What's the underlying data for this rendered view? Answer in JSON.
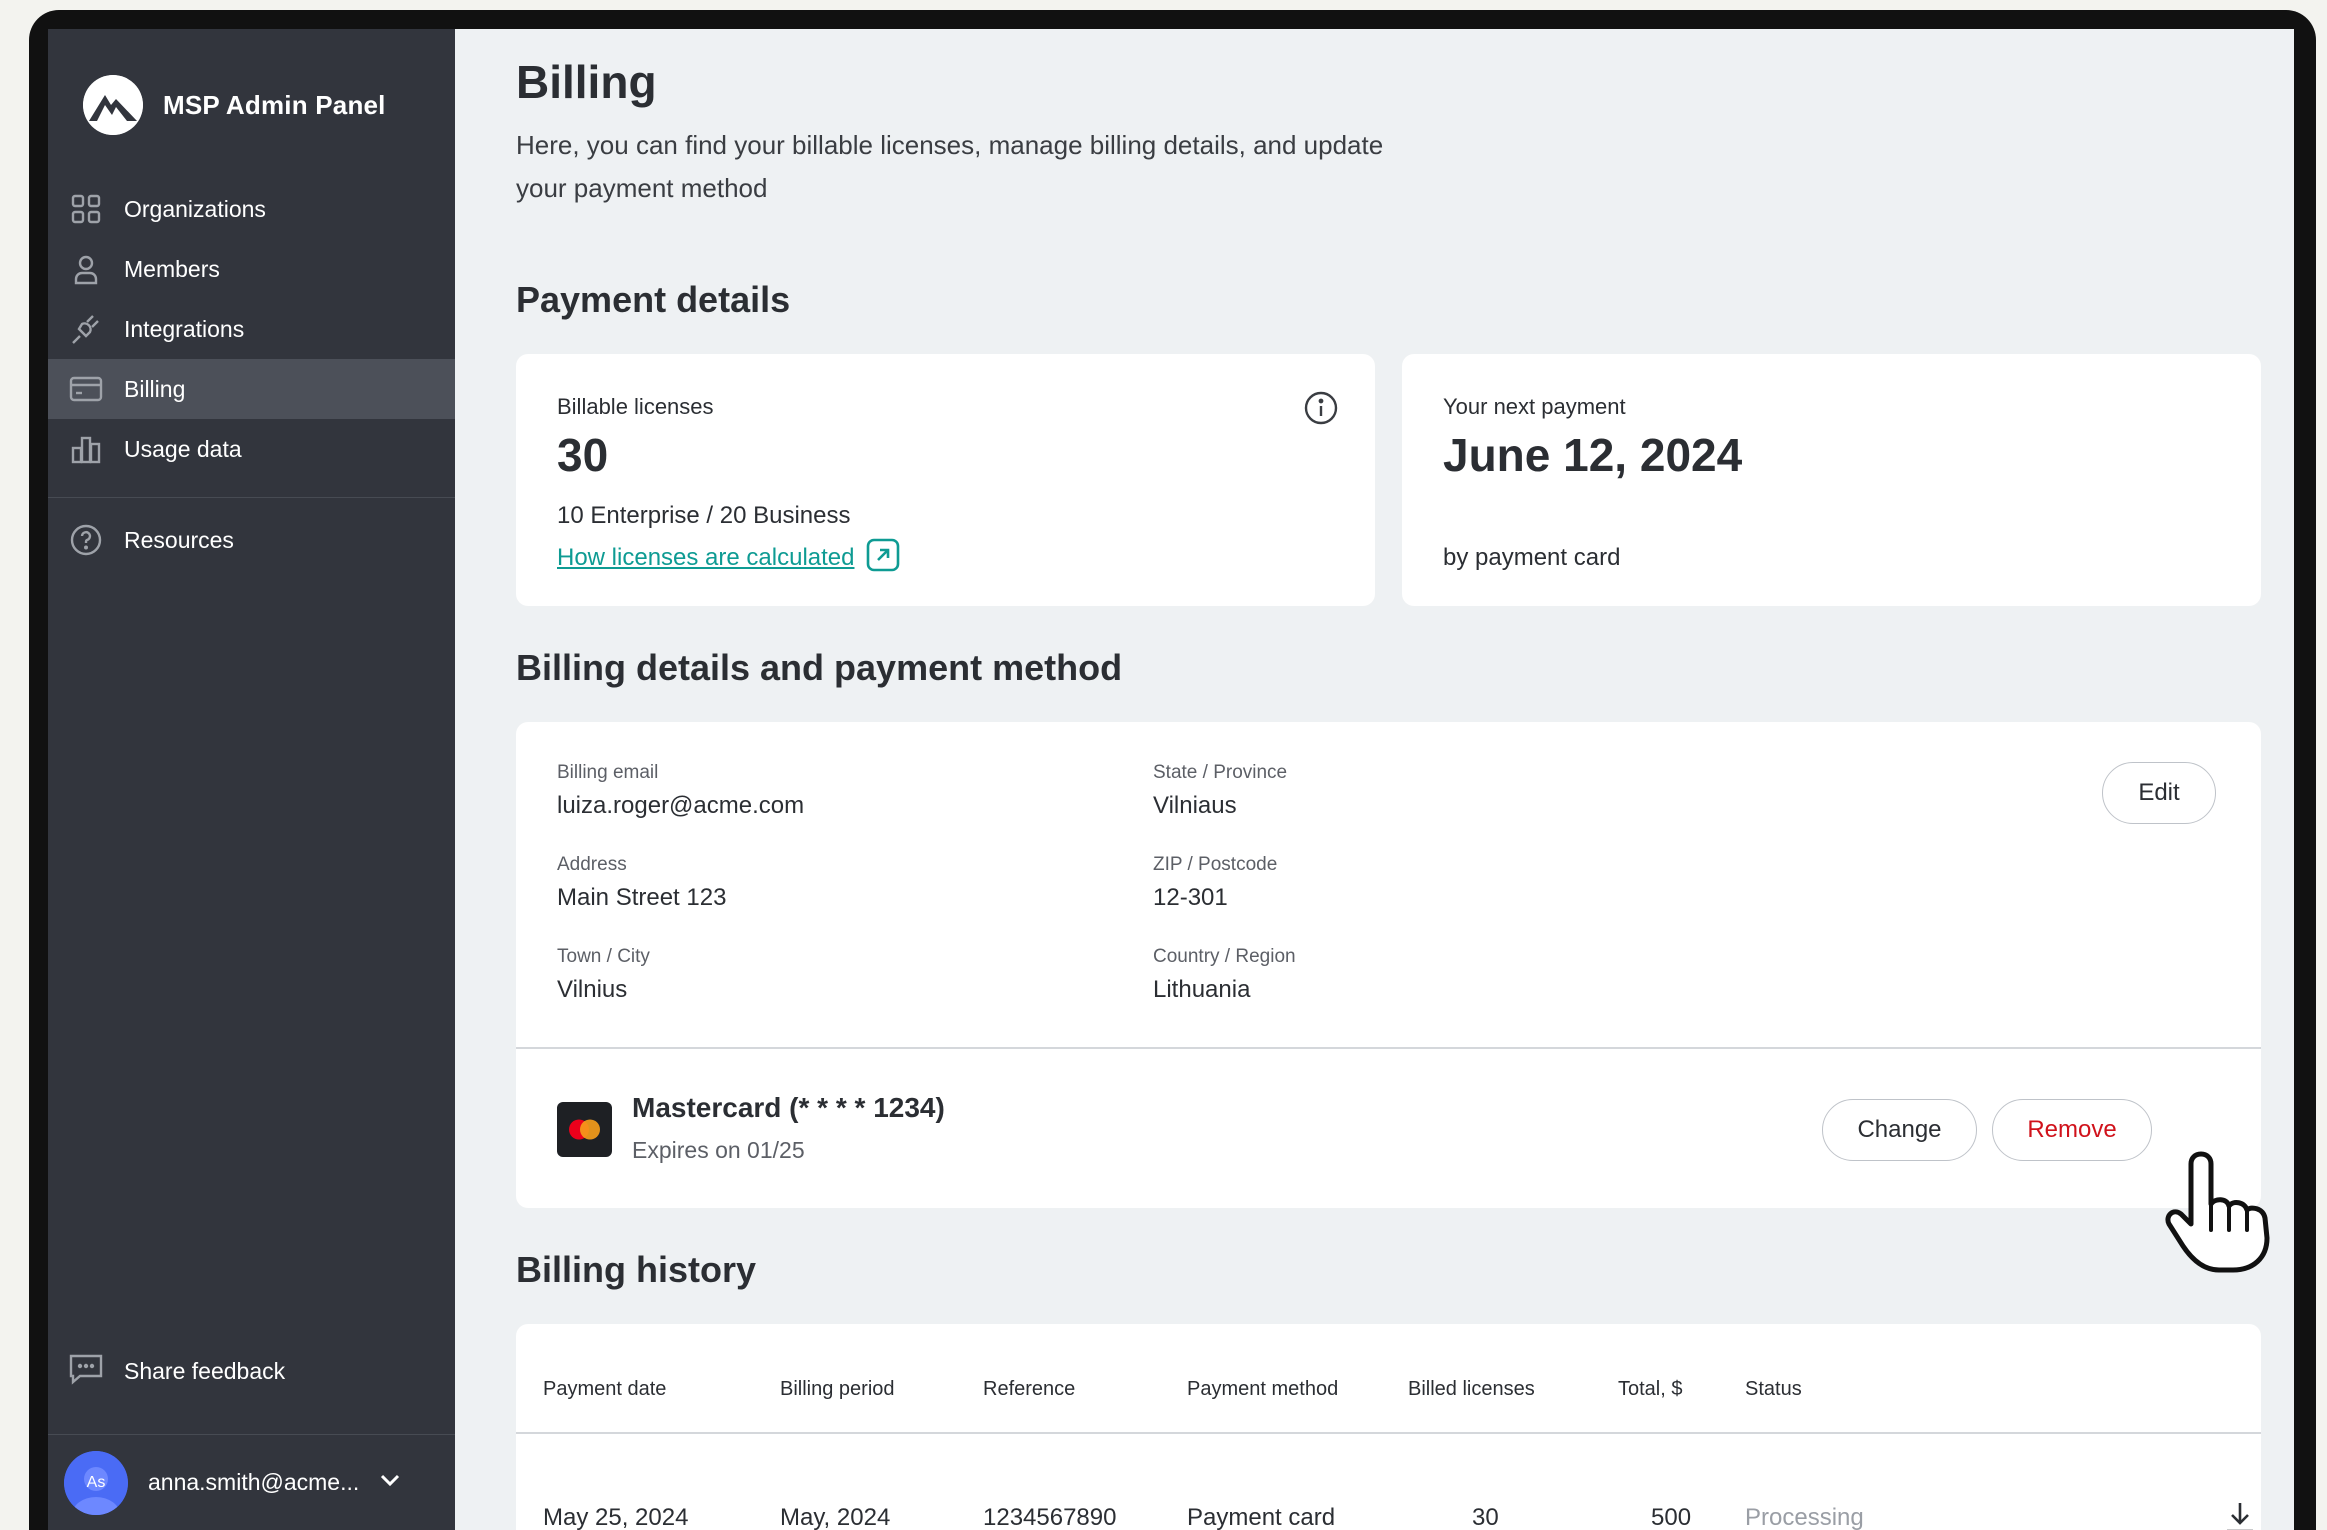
{
  "app": {
    "name": "MSP Admin Panel"
  },
  "sidebar": {
    "items": [
      {
        "label": "Organizations",
        "icon": "grid-icon"
      },
      {
        "label": "Members",
        "icon": "person-icon"
      },
      {
        "label": "Integrations",
        "icon": "plug-icon"
      },
      {
        "label": "Billing",
        "icon": "card-icon",
        "active": true
      },
      {
        "label": "Usage data",
        "icon": "bar-chart-icon"
      }
    ],
    "resources": "Resources",
    "feedback": "Share feedback",
    "user": {
      "initials": "As",
      "email": "anna.smith@acme..."
    }
  },
  "page": {
    "title": "Billing",
    "subtitle": "Here, you can find your billable licenses, manage billing details, and update your payment method"
  },
  "payment_details": {
    "heading": "Payment details",
    "licenses": {
      "label": "Billable licenses",
      "count": "30",
      "breakdown": "10 Enterprise / 20 Business",
      "link": "How licenses are calculated"
    },
    "next_payment": {
      "label": "Your next payment",
      "date": "June 12, 2024",
      "method": "by payment card"
    }
  },
  "billing_details": {
    "heading": "Billing details and payment method",
    "fields": {
      "email": {
        "label": "Billing email",
        "value": "luiza.roger@acme.com"
      },
      "address": {
        "label": "Address",
        "value": "Main Street 123"
      },
      "city": {
        "label": "Town / City",
        "value": "Vilnius"
      },
      "state": {
        "label": "State / Province",
        "value": "Vilniaus"
      },
      "zip": {
        "label": "ZIP / Postcode",
        "value": "12-301"
      },
      "country": {
        "label": "Country / Region",
        "value": "Lithuania"
      }
    },
    "edit_label": "Edit",
    "card": {
      "name": "Mastercard (* * * * 1234)",
      "expires": "Expires on 01/25",
      "change_label": "Change",
      "remove_label": "Remove"
    }
  },
  "billing_history": {
    "heading": "Billing history",
    "columns": [
      "Payment date",
      "Billing period",
      "Reference",
      "Payment method",
      "Billed licenses",
      "Total, $",
      "Status"
    ],
    "rows": [
      {
        "date": "May 25, 2024",
        "period": "May, 2024",
        "reference": "1234567890",
        "method": "Payment card",
        "licenses": "30",
        "total": "500",
        "status": "Processing"
      }
    ]
  },
  "colors": {
    "accent": "#0e9b93",
    "danger": "#d0121b",
    "sidebar": "#32353d",
    "avatar": "#4a6bf5"
  }
}
